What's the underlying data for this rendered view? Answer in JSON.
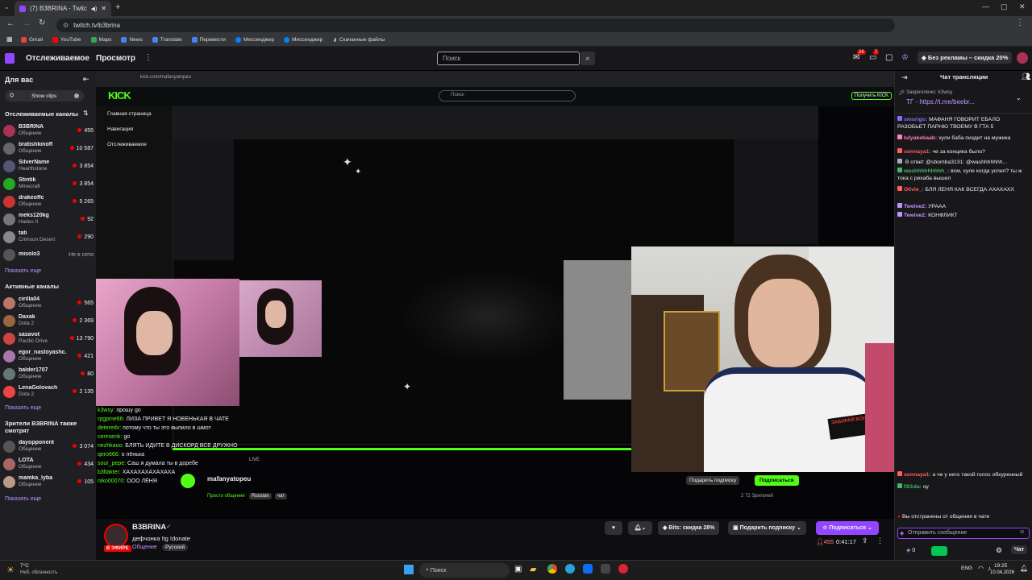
{
  "browser": {
    "tab_title": "(7) B3BRINA - Twitch",
    "url": "twitch.tv/b3brina",
    "bookmarks": [
      {
        "label": "Gmail",
        "color": "#ea4335"
      },
      {
        "label": "YouTube",
        "color": "#ff0000"
      },
      {
        "label": "Maps",
        "color": "#34a853"
      },
      {
        "label": "News",
        "color": "#4285f4"
      },
      {
        "label": "Translate",
        "color": "#4285f4"
      },
      {
        "label": "Перевести",
        "color": "#4285f4"
      },
      {
        "label": "Мессенджер",
        "color": "#0084ff"
      },
      {
        "label": "Мессенджер",
        "color": "#0084ff"
      },
      {
        "label": "Скачанные файлы",
        "color": "#dddddd"
      }
    ]
  },
  "nav": {
    "following": "Отслеживаемое",
    "browse": "Просмотр",
    "search_placeholder": "Поиск",
    "notif_badge": "26",
    "inbox_badge": "7",
    "promo": "Без рекламы – скидка 20%"
  },
  "sidebar": {
    "title": "Для вас",
    "show_clips": "Show clips",
    "followed_header": "Отслеживаемые каналы",
    "followed": [
      {
        "name": "B3BRINA",
        "game": "Общение",
        "viewers": "455",
        "color": "#a35"
      },
      {
        "name": "bratishkinoff",
        "game": "Общение",
        "viewers": "10 587",
        "color": "#666"
      },
      {
        "name": "SilverName",
        "game": "Hearthstone",
        "viewers": "3 854",
        "color": "#557"
      },
      {
        "name": "Stintik",
        "game": "Minecraft",
        "viewers": "3 854",
        "color": "#2a2"
      },
      {
        "name": "drakeoffc",
        "game": "Общение",
        "viewers": "5 265",
        "color": "#c33"
      },
      {
        "name": "meks120kg",
        "game": "Hades II",
        "viewers": "92",
        "color": "#777"
      },
      {
        "name": "tati",
        "game": "Crimson Desert",
        "viewers": "290",
        "color": "#888"
      },
      {
        "name": "misolo3",
        "game": "",
        "viewers": "Не в сети",
        "color": "#555"
      }
    ],
    "show_more": "Показать еще",
    "active_header": "Активные каналы",
    "active": [
      {
        "name": "cirilla04",
        "game": "Общение",
        "viewers": "565",
        "color": "#b76"
      },
      {
        "name": "Daxak",
        "game": "Dota 2",
        "viewers": "2 369",
        "color": "#964"
      },
      {
        "name": "sasavot",
        "game": "Pacific Drive",
        "viewers": "13 790",
        "color": "#c44"
      },
      {
        "name": "egor_nastoyashc...",
        "game": "Общение",
        "viewers": "421",
        "color": "#a7a"
      },
      {
        "name": "balder1707",
        "game": "Общение",
        "viewers": "80",
        "color": "#677"
      },
      {
        "name": "LenaGolovach",
        "game": "Dota 2",
        "viewers": "2 135",
        "color": "#e44"
      }
    ],
    "show_more2": "Показать еще",
    "also_header": "Зрители B3BRINA также смотрят",
    "also": [
      {
        "name": "dayopponent",
        "game": "Общение",
        "viewers": "3 074",
        "color": "#555"
      },
      {
        "name": "LOTA",
        "game": "Общение",
        "viewers": "434",
        "color": "#a66"
      },
      {
        "name": "mamka_lyba",
        "game": "Общение",
        "viewers": "105",
        "color": "#b98"
      }
    ],
    "show_more3": "Показать еще"
  },
  "video": {
    "inner_url": "kick.com/mafanyatopeu",
    "kick_logo": "KICK",
    "kick_search": "Поиск",
    "kick_nav": [
      "Главная страница",
      "Навигация",
      "Отслеживаемое"
    ],
    "kick_get": "Получить KICK",
    "kick_chat": "Чат",
    "kick_channel": "mafanyatopeu",
    "kick_category": "Просто общение",
    "kick_lang": "Russian",
    "kick_tag": "чат",
    "kick_viewers": "2 72",
    "kick_viewers_label": "Зрителей",
    "kick_subscribe": "Подписаться",
    "kick_sub_gift": "Подарить подписку",
    "kick_chat_lines": [
      {
        "user": "k3wsy:",
        "text": "прошу go"
      },
      {
        "user": "rpgpme66:",
        "text": "ЛИЗА ПРИВЕТ Я НОВЕНЬКАЯ В ЧАТЕ"
      },
      {
        "user": "deteredv:",
        "text": "потому что ты это выпило в шмот"
      },
      {
        "user": "ceresenk:",
        "text": "go"
      },
      {
        "user": "nezhkaoo:",
        "text": "БЛЯТЬ ИДИТЕ В ДИСКОРД ВСЕ ДРУЖНО"
      },
      {
        "user": "qero666:",
        "text": "о лёнька"
      },
      {
        "user": "sour_pepe:",
        "text": "Саш я думала ты в доребе"
      },
      {
        "user": "b3ltakter:",
        "text": "ХАХАХАХАХАХАХА"
      },
      {
        "user": "niko00070:",
        "text": "ООО ЛЁНЯ"
      }
    ],
    "time_live": "LIVE",
    "stamp_text": "ЗАБИРАЙ БОНУС"
  },
  "channel": {
    "name": "B3BRINA",
    "title": "дефчонка !tg !donate",
    "category": "Общение",
    "tag": "Русский",
    "live": "В ЭФИРЕ",
    "viewers": "455",
    "uptime": "0:41:17",
    "bits": "Bits: скидка 28%",
    "gift": "Подарить подписку",
    "subscribe": "Подписаться"
  },
  "chat": {
    "title": "Чат трансляции",
    "pinned": "Закреплено: k3wsy",
    "pinned_text": "ТГ - https://t.me/beebr...",
    "messages": [
      {
        "user": "smurigo:",
        "color": "#8a6cff",
        "text": "МАФАНЯ ГОВОРИТ ЕБАЛО РАЗОБЬЕТ ПАРНЮ ТВОЕМУ В ГТА 5"
      },
      {
        "user": "lulyakebaab:",
        "color": "#ff7fbf",
        "text": "хули баба пиздит на мужика"
      },
      {
        "user": "sonnaya1:",
        "color": "#ff5f5f",
        "text": "че за концика было?"
      },
      {
        "user": "",
        "color": "#adadb8",
        "text": "В ответ @sbomba3131: @washhhhhhh..."
      },
      {
        "user": "washhhhhhhhh_:",
        "color": "#3fb96a",
        "text": "всм, хуле когда успел? ты ж тока с рехаба вышел"
      },
      {
        "user": "Olivie_:",
        "color": "#ff5f5f",
        "text": "БЛЯ ЛЕНЯ КАК ВСЕГДА АХАХАХХ"
      },
      {
        "user": "Twelve2:",
        "color": "#bf94ff",
        "text": "УРААА"
      },
      {
        "user": "Twelve2:",
        "color": "#bf94ff",
        "text": "КОНФЛИКТ"
      },
      {
        "user": "sonnaya1:",
        "color": "#ff5f5f",
        "text": "а че у него такой голос обкуренный"
      },
      {
        "user": "f3l1da:",
        "color": "#3fb96a",
        "text": "оу"
      }
    ],
    "banned": "Вы отстранены от общения в чате",
    "input_placeholder": "Отправить сообщение",
    "points": "0",
    "send": "Чат"
  },
  "taskbar": {
    "temp": "7°C",
    "weather": "Неб. облачность",
    "search": "Поиск",
    "lang": "ENG",
    "time": "19:25",
    "date": "10.04.2026"
  }
}
